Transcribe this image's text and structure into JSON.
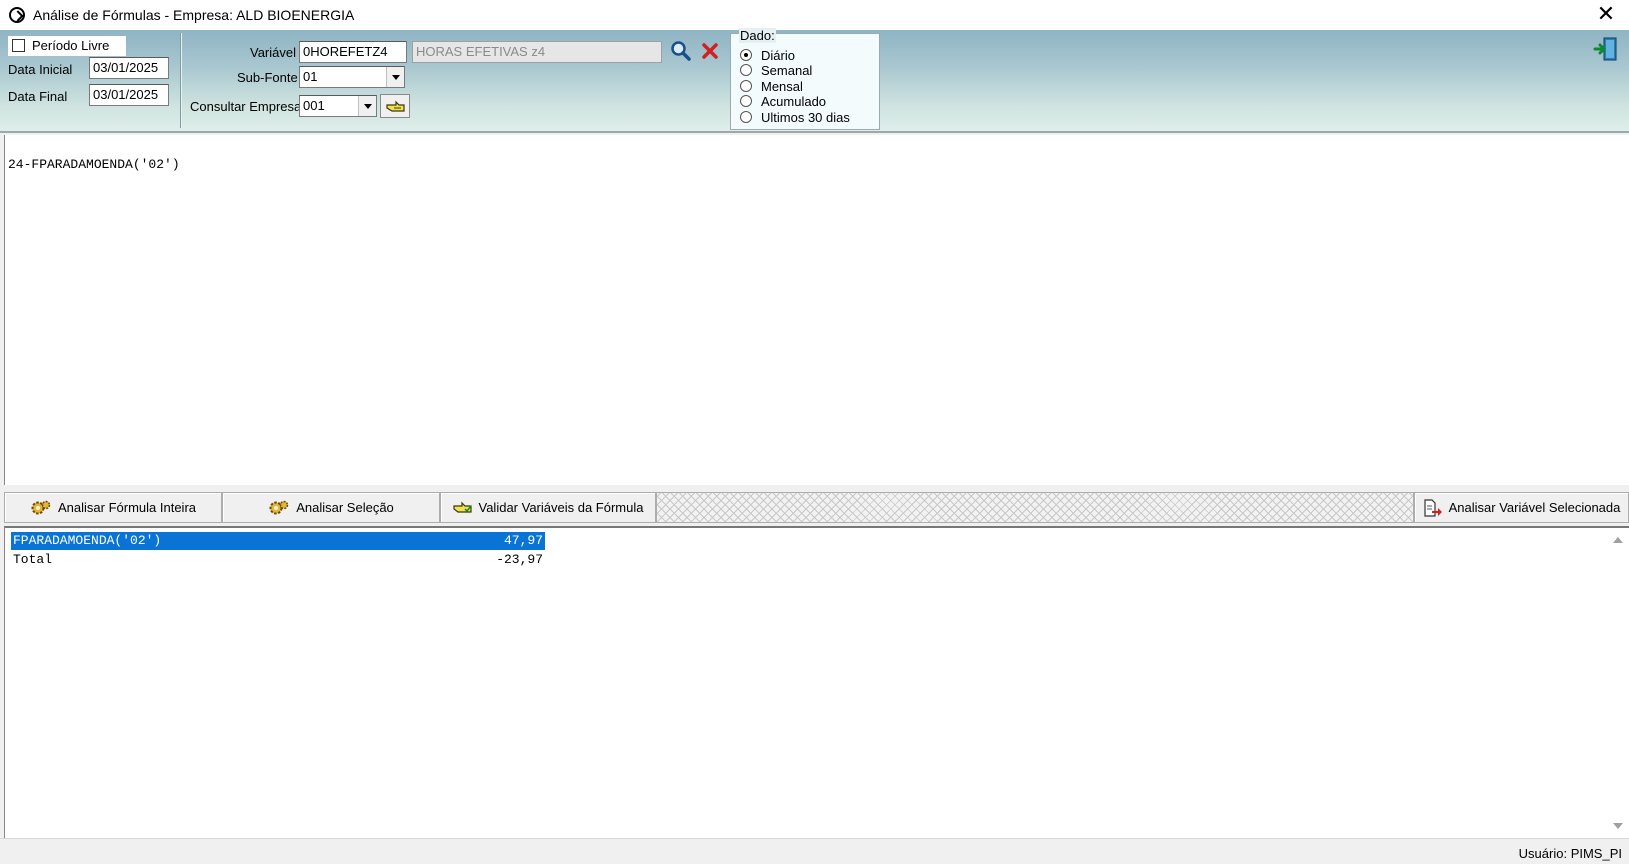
{
  "window": {
    "title": "Análise de Fórmulas  -  Empresa: ALD BIOENERGIA",
    "close": "✕"
  },
  "filters": {
    "periodo_livre": {
      "label": "Período Livre",
      "checked": false
    },
    "data_inicial": {
      "label": "Data Inicial",
      "value": "03/01/2025"
    },
    "data_final": {
      "label": "Data Final",
      "value": "03/01/2025"
    },
    "variavel": {
      "label": "Variável",
      "code": "0HOREFETZ4",
      "description": "HORAS EFETIVAS z4"
    },
    "sub_fonte": {
      "label": "Sub-Fonte",
      "value": "01"
    },
    "consultar_empresa": {
      "label": "Consultar Empresa",
      "value": "001"
    }
  },
  "dado": {
    "title": "Dado:",
    "options": [
      "Diário",
      "Semanal",
      "Mensal",
      "Acumulado",
      "Ultimos 30 dias"
    ],
    "selected": "Diário"
  },
  "formula": {
    "text": "24-FPARADAMOENDA('02')"
  },
  "buttons": {
    "analisar_formula_inteira": "Analisar Fórmula Inteira",
    "analisar_selecao": "Analisar Seleção",
    "validar_variaveis": "Validar Variáveis da Fórmula",
    "analisar_variavel_selecionada": "Analisar Variável Selecionada"
  },
  "results": [
    {
      "name": "FPARADAMOENDA('02')",
      "value": "47,97",
      "selected": true
    },
    {
      "name": "Total",
      "value": "-23,97",
      "selected": false
    }
  ],
  "status": {
    "user": "Usuário: PIMS_PI"
  },
  "colors": {
    "selection": "#0a74d6",
    "toolbar_top": "#8fb4c4",
    "toolbar_bottom": "#dfeee9",
    "delete_red": "#d21f1f"
  },
  "icons": [
    "app-icon",
    "close-icon",
    "search-icon",
    "delete-icon",
    "hand-pointer-icon",
    "exit-door-icon",
    "gears-icon",
    "hand-check-icon",
    "document-arrow-icon"
  ]
}
